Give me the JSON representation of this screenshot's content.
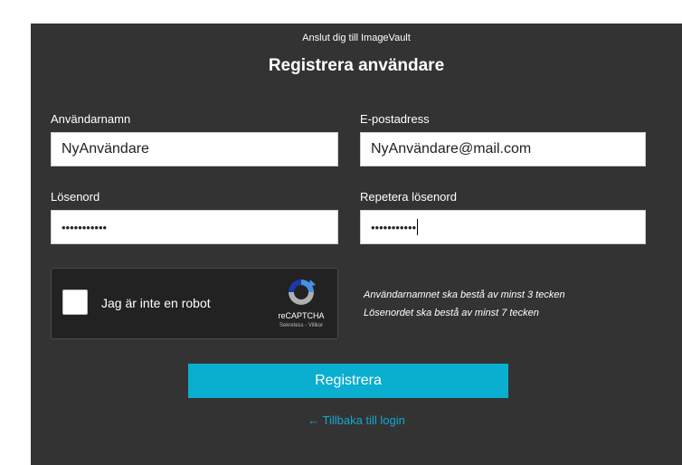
{
  "header": {
    "subtitle": "Anslut dig till ImageVault",
    "title": "Registrera användare"
  },
  "form": {
    "username": {
      "label": "Användarnamn",
      "value": "NyAnvändare"
    },
    "email": {
      "label": "E-postadress",
      "value": "NyAnvändare@mail.com"
    },
    "password": {
      "label": "Lösenord",
      "value": "•••••••••••"
    },
    "repeat_password": {
      "label": "Repetera lösenord",
      "value": "•••••••••••"
    }
  },
  "captcha": {
    "checkbox_label": "Jag är inte en robot",
    "brand": "reCAPTCHA",
    "links": "Sekretess - Villkor",
    "checked": false
  },
  "hints": {
    "username_rule": "Användarnamnet ska bestå av minst 3 tecken",
    "password_rule": "Lösenordet ska bestå av minst 7 tecken"
  },
  "actions": {
    "register_label": "Registrera",
    "back_arrow": "←",
    "back_label": "Tillbaka till login"
  },
  "colors": {
    "panel_bg": "#333333",
    "accent": "#0aaecf",
    "link": "#12a8d0"
  },
  "icons": {
    "back": "arrow-left-icon",
    "captcha": "recaptcha-logo-icon"
  }
}
